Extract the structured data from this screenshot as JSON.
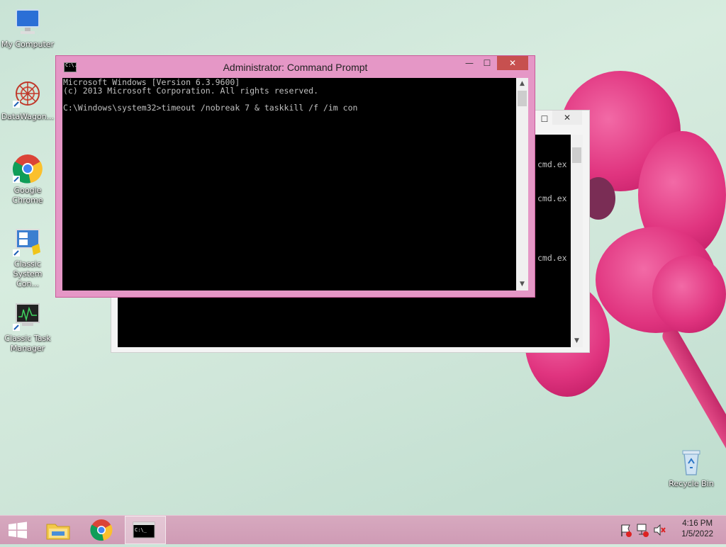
{
  "desktop": {
    "icons": [
      {
        "label": "My Computer",
        "icon": "monitor-icon"
      },
      {
        "label": "DataWagon...",
        "icon": "datawagon-icon"
      },
      {
        "label": "Google Chrome",
        "icon": "chrome-icon"
      },
      {
        "label": "Classic System Con...",
        "icon": "control-panel-icon"
      },
      {
        "label": "Classic Task Manager",
        "icon": "task-manager-icon"
      },
      {
        "label": "Recycle Bin",
        "icon": "recycle-bin-icon"
      }
    ]
  },
  "cmd_window": {
    "title": "Administrator: Command Prompt",
    "icon_text": "C:\\.",
    "lines": [
      "Microsoft Windows [Version 6.3.9600]",
      "(c) 2013 Microsoft Corporation. All rights reserved.",
      "",
      "C:\\Windows\\system32>timeout /nobreak 7 & taskkill /f /im con"
    ],
    "controls": {
      "minimize": "—",
      "maximize": "☐",
      "close": "✕"
    }
  },
  "back_window": {
    "visible_text": [
      "cmd.ex",
      "cmd.ex",
      "cmd.ex"
    ],
    "controls": {
      "maximize": "☐",
      "close": "✕"
    }
  },
  "taskbar": {
    "items": [
      {
        "name": "start",
        "icon": "windows-logo-icon"
      },
      {
        "name": "file-explorer",
        "icon": "folder-icon"
      },
      {
        "name": "chrome",
        "icon": "chrome-icon"
      },
      {
        "name": "command-prompt",
        "icon": "cmd-icon",
        "active": true
      }
    ],
    "tray_icons": [
      "flag-icon",
      "network-icon",
      "speaker-muted-icon"
    ],
    "time": "4:16 PM",
    "date": "1/5/2022"
  }
}
